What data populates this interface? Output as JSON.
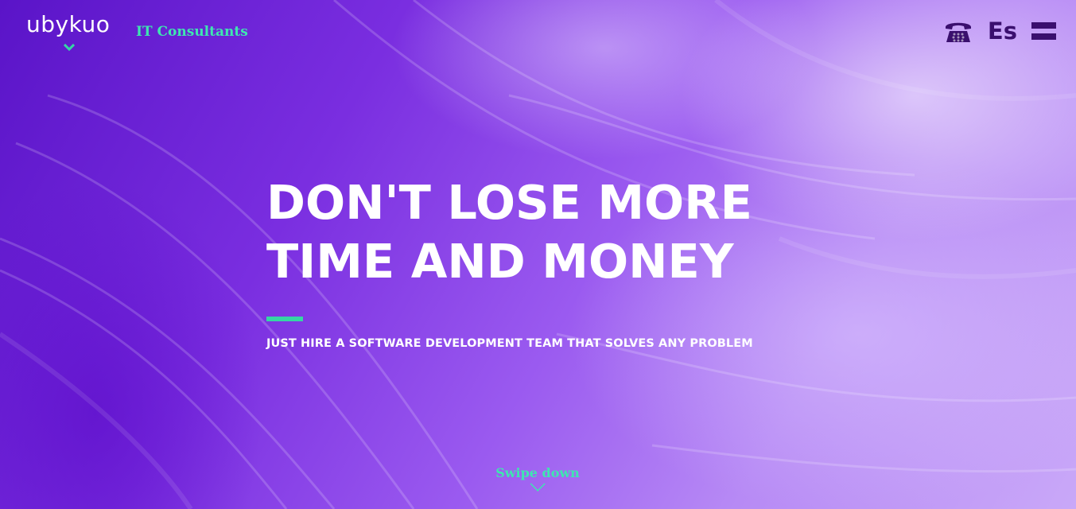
{
  "header": {
    "logo_text": "ubykuo",
    "tagline": "IT Consultants",
    "language_label": "Es"
  },
  "hero": {
    "headline_line1": "DON'T LOSE MORE",
    "headline_line2": "TIME AND MONEY",
    "subheadline": "JUST HIRE A SOFTWARE DEVELOPMENT TEAM THAT SOLVES ANY PROBLEM",
    "swipe_label": "Swipe down"
  },
  "icons": {
    "logo_chevron": "chevron-down-icon",
    "phone": "phone-icon",
    "menu": "hamburger-menu-icon",
    "swipe_chevron": "chevron-down-icon"
  },
  "colors": {
    "accent_green": "#35d6a4",
    "dark_purple": "#3a0f6e",
    "background_purple": "#7a2ee0",
    "text_white": "#ffffff"
  }
}
